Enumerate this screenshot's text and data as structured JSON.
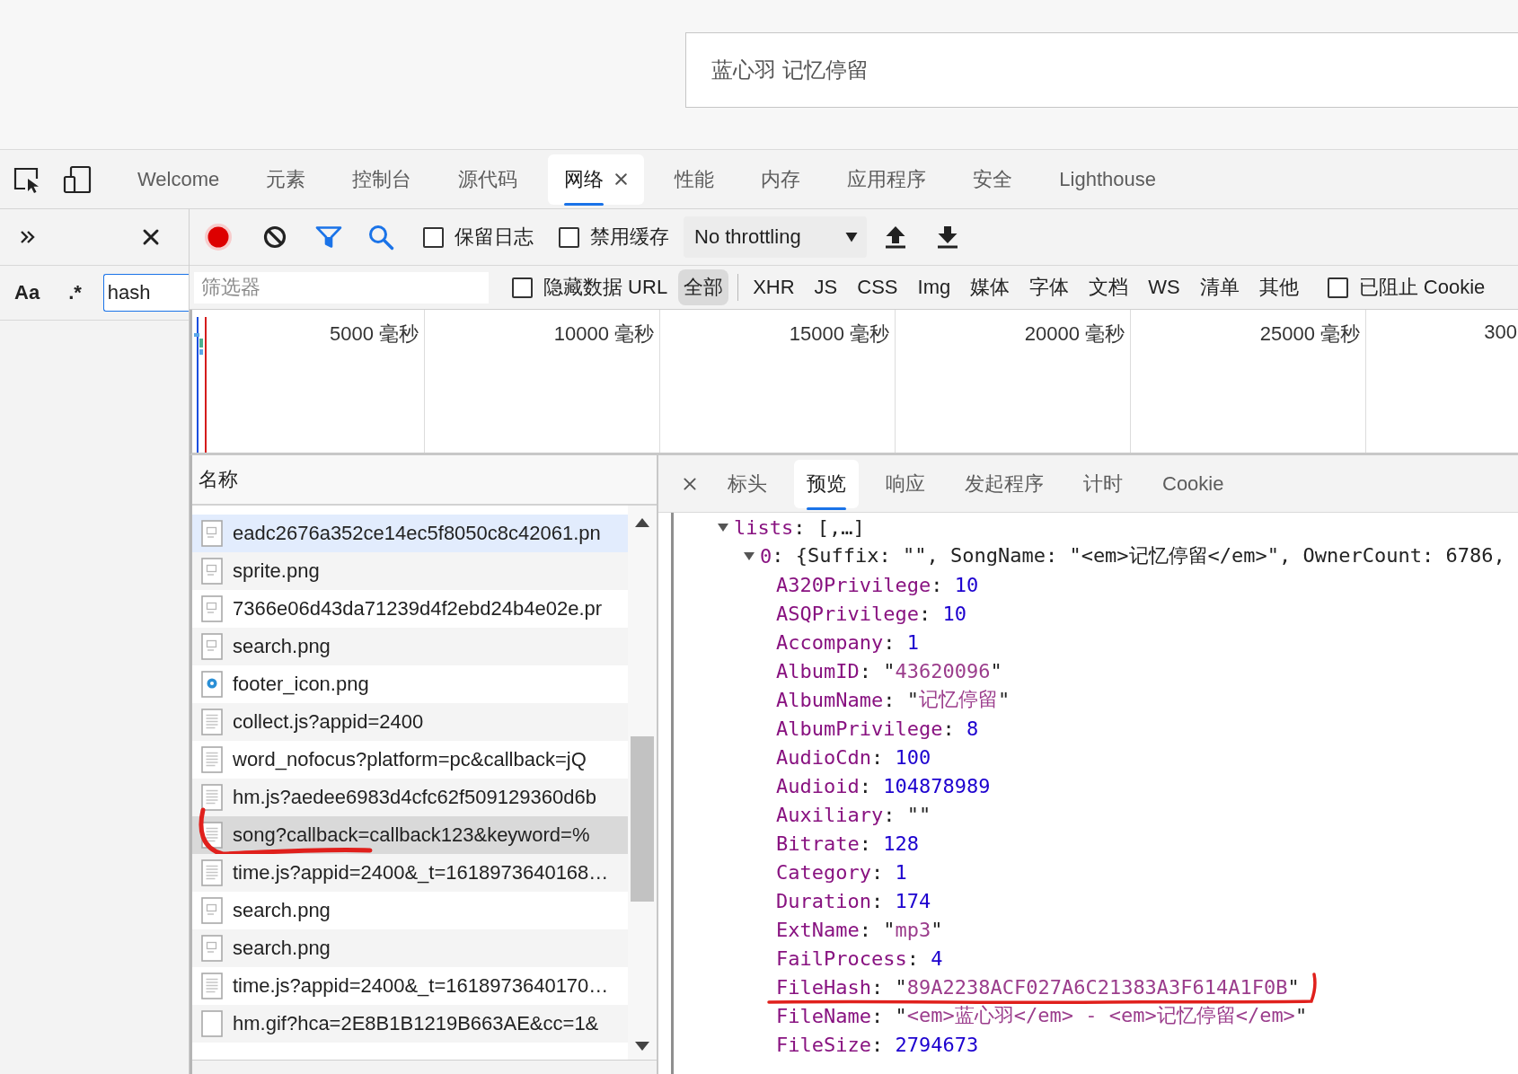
{
  "page": {
    "search": {
      "value": "蓝心羽 记忆停留"
    }
  },
  "devtools": {
    "tabs": [
      {
        "label": "Welcome",
        "selected": false
      },
      {
        "label": "元素",
        "selected": false
      },
      {
        "label": "控制台",
        "selected": false
      },
      {
        "label": "源代码",
        "selected": false
      },
      {
        "label": "网络",
        "selected": true
      },
      {
        "label": "性能",
        "selected": false
      },
      {
        "label": "内存",
        "selected": false
      },
      {
        "label": "应用程序",
        "selected": false
      },
      {
        "label": "安全",
        "selected": false
      },
      {
        "label": "Lighthouse",
        "selected": false
      }
    ]
  },
  "search_panel": {
    "match_case": "Aa",
    "regex": ".*",
    "query": "hash"
  },
  "network_toolbar": {
    "recording": true,
    "checkboxes": [
      {
        "label": "保留日志",
        "checked": false
      },
      {
        "label": "禁用缓存",
        "checked": false
      }
    ],
    "throttling": "No throttling"
  },
  "filter_bar": {
    "placeholder": "筛选器",
    "hide_data_urls": {
      "label": "隐藏数据 URL",
      "checked": false
    },
    "types": [
      {
        "label": "全部",
        "selected": true
      },
      {
        "label": "XHR",
        "selected": false
      },
      {
        "label": "JS",
        "selected": false
      },
      {
        "label": "CSS",
        "selected": false
      },
      {
        "label": "Img",
        "selected": false
      },
      {
        "label": "媒体",
        "selected": false
      },
      {
        "label": "字体",
        "selected": false
      },
      {
        "label": "文档",
        "selected": false
      },
      {
        "label": "WS",
        "selected": false
      },
      {
        "label": "清单",
        "selected": false
      },
      {
        "label": "其他",
        "selected": false
      }
    ],
    "blocked_cookies": {
      "label": "已阻止 Cookie",
      "checked": false
    }
  },
  "overview": {
    "ticks": [
      "5000 毫秒",
      "10000 毫秒",
      "15000 毫秒",
      "20000 毫秒",
      "25000 毫秒",
      "300"
    ]
  },
  "requests": {
    "column": "名称",
    "rows": [
      {
        "name": "eadc2676a352ce14ec5f8050c8c42061.pn",
        "kind": "image",
        "selected": false,
        "hovered": true,
        "annotated": false
      },
      {
        "name": "sprite.png",
        "kind": "image",
        "selected": false,
        "hovered": false,
        "annotated": false
      },
      {
        "name": "7366e06d43da71239d4f2ebd24b4e02e.pr",
        "kind": "image",
        "selected": false,
        "hovered": false,
        "annotated": false
      },
      {
        "name": "search.png",
        "kind": "image",
        "selected": false,
        "hovered": false,
        "annotated": false
      },
      {
        "name": "footer_icon.png",
        "kind": "logo",
        "selected": false,
        "hovered": false,
        "annotated": false
      },
      {
        "name": "collect.js?appid=2400",
        "kind": "script",
        "selected": false,
        "hovered": false,
        "annotated": false
      },
      {
        "name": "word_nofocus?platform=pc&callback=jQ",
        "kind": "script",
        "selected": false,
        "hovered": false,
        "annotated": false
      },
      {
        "name": "hm.js?aedee6983d4cfc62f509129360d6b",
        "kind": "script",
        "selected": false,
        "hovered": false,
        "annotated": false
      },
      {
        "name": "song?callback=callback123&keyword=%",
        "kind": "script",
        "selected": true,
        "hovered": false,
        "annotated": true
      },
      {
        "name": "time.js?appid=2400&_t=1618973640168…",
        "kind": "script",
        "selected": false,
        "hovered": false,
        "annotated": false
      },
      {
        "name": "search.png",
        "kind": "image",
        "selected": false,
        "hovered": false,
        "annotated": false
      },
      {
        "name": "search.png",
        "kind": "image",
        "selected": false,
        "hovered": false,
        "annotated": false
      },
      {
        "name": "time.js?appid=2400&_t=1618973640170…",
        "kind": "script",
        "selected": false,
        "hovered": false,
        "annotated": false
      },
      {
        "name": "hm.gif?hca=2E8B1B1219B663AE&cc=1&",
        "kind": "blank",
        "selected": false,
        "hovered": false,
        "annotated": false
      }
    ]
  },
  "details": {
    "tabs": [
      {
        "label": "标头",
        "selected": false
      },
      {
        "label": "预览",
        "selected": true
      },
      {
        "label": "响应",
        "selected": false
      },
      {
        "label": "发起程序",
        "selected": false
      },
      {
        "label": "计时",
        "selected": false
      },
      {
        "label": "Cookie",
        "selected": false
      }
    ],
    "preview": {
      "separator": ": ",
      "nodes": [
        {
          "key": "lists",
          "summary": "[,…]",
          "expanded": true,
          "children": [
            {
              "key": "0",
              "summary": "{Suffix: \"\", SongName: \"<em>记忆停留</em>\", OwnerCount: 6786,",
              "expanded": true,
              "children": [
                {
                  "key": "A320Privilege",
                  "value": "10",
                  "kind": "number",
                  "annotated": false
                },
                {
                  "key": "ASQPrivilege",
                  "value": "10",
                  "kind": "number",
                  "annotated": false
                },
                {
                  "key": "Accompany",
                  "value": "1",
                  "kind": "number",
                  "annotated": false
                },
                {
                  "key": "AlbumID",
                  "value": "\"43620096\"",
                  "kind": "string",
                  "annotated": false
                },
                {
                  "key": "AlbumName",
                  "value": "\"记忆停留\"",
                  "kind": "string",
                  "annotated": false
                },
                {
                  "key": "AlbumPrivilege",
                  "value": "8",
                  "kind": "number",
                  "annotated": false
                },
                {
                  "key": "AudioCdn",
                  "value": "100",
                  "kind": "number",
                  "annotated": false
                },
                {
                  "key": "Audioid",
                  "value": "104878989",
                  "kind": "number",
                  "annotated": false
                },
                {
                  "key": "Auxiliary",
                  "value": "\"\"",
                  "kind": "string",
                  "annotated": false
                },
                {
                  "key": "Bitrate",
                  "value": "128",
                  "kind": "number",
                  "annotated": false
                },
                {
                  "key": "Category",
                  "value": "1",
                  "kind": "number",
                  "annotated": false
                },
                {
                  "key": "Duration",
                  "value": "174",
                  "kind": "number",
                  "annotated": false
                },
                {
                  "key": "ExtName",
                  "value": "\"mp3\"",
                  "kind": "string",
                  "annotated": false
                },
                {
                  "key": "FailProcess",
                  "value": "4",
                  "kind": "number",
                  "annotated": false
                },
                {
                  "key": "FileHash",
                  "value": "\"89A2238ACF027A6C21383A3F614A1F0B\"",
                  "kind": "string",
                  "annotated": true
                },
                {
                  "key": "FileName",
                  "value": "\"<em>蓝心羽</em> - <em>记忆停留</em>\"",
                  "kind": "string",
                  "annotated": false
                },
                {
                  "key": "FileSize",
                  "value": "2794673",
                  "kind": "number",
                  "annotated": false
                }
              ]
            }
          ]
        }
      ]
    }
  }
}
